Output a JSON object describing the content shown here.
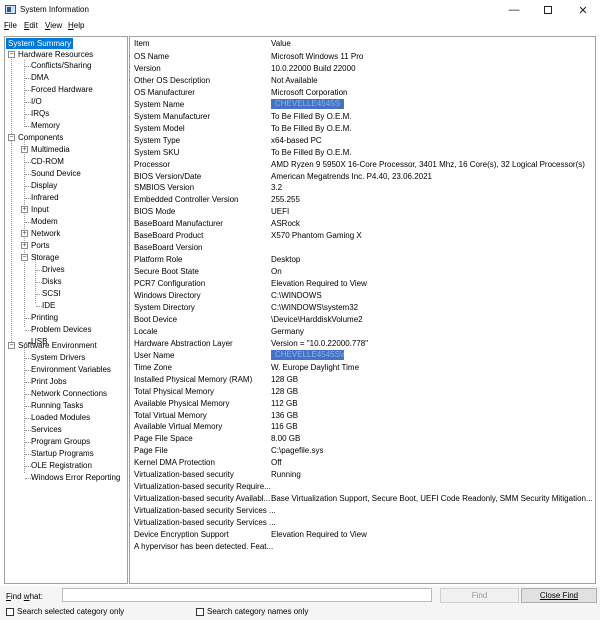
{
  "window": {
    "title": "System Information",
    "minimize": "—",
    "close": "✕"
  },
  "menu": [
    {
      "label": "File"
    },
    {
      "label": "Edit"
    },
    {
      "label": "View"
    },
    {
      "label": "Help"
    }
  ],
  "tree": {
    "system_summary": "System Summary",
    "hardware_resources": "Hardware Resources",
    "hardware_children": [
      "Conflicts/Sharing",
      "DMA",
      "Forced Hardware",
      "I/O",
      "IRQs",
      "Memory"
    ],
    "components": "Components",
    "components_children": [
      "Multimedia",
      "CD-ROM",
      "Sound Device",
      "Display",
      "Infrared",
      "Input",
      "Modem",
      "Network",
      "Ports",
      "Storage"
    ],
    "storage_children": [
      "Drives",
      "Disks",
      "SCSI",
      "IDE"
    ],
    "components_children_2": [
      "Printing",
      "Problem Devices",
      "USB"
    ],
    "software_environment": "Software Environment",
    "software_children": [
      "System Drivers",
      "Environment Variables",
      "Print Jobs",
      "Network Connections",
      "Running Tasks",
      "Loaded Modules",
      "Services",
      "Program Groups",
      "Startup Programs",
      "OLE Registration",
      "Windows Error Reporting"
    ]
  },
  "table": {
    "headers": [
      "Item",
      "Value"
    ],
    "rows": [
      [
        "OS Name",
        "Microsoft Windows 11 Pro"
      ],
      [
        "Version",
        "10.0.22000 Build 22000"
      ],
      [
        "Other OS Description",
        "Not Available"
      ],
      [
        "OS Manufacturer",
        "Microsoft Corporation"
      ],
      [
        "System Name",
        "CHEVELLE4545S"
      ],
      [
        "System Manufacturer",
        "To Be Filled By O.E.M."
      ],
      [
        "System Model",
        "To Be Filled By O.E.M."
      ],
      [
        "System Type",
        "x64-based PC"
      ],
      [
        "System SKU",
        "To Be Filled By O.E.M."
      ],
      [
        "Processor",
        "AMD Ryzen 9 5950X 16-Core Processor, 3401 Mhz, 16 Core(s), 32 Logical Processor(s)"
      ],
      [
        "BIOS Version/Date",
        "American Megatrends Inc. P4.40, 23.06.2021"
      ],
      [
        "SMBIOS Version",
        "3.2"
      ],
      [
        "Embedded Controller Version",
        "255.255"
      ],
      [
        "BIOS Mode",
        "UEFI"
      ],
      [
        "BaseBoard Manufacturer",
        "ASRock"
      ],
      [
        "BaseBoard Product",
        "X570 Phantom Gaming X"
      ],
      [
        "BaseBoard Version",
        ""
      ],
      [
        "Platform Role",
        "Desktop"
      ],
      [
        "Secure Boot State",
        "On"
      ],
      [
        "PCR7 Configuration",
        "Elevation Required to View"
      ],
      [
        "Windows Directory",
        "C:\\WINDOWS"
      ],
      [
        "System Directory",
        "C:\\WINDOWS\\system32"
      ],
      [
        "Boot Device",
        "\\Device\\HarddiskVolume2"
      ],
      [
        "Locale",
        "Germany"
      ],
      [
        "Hardware Abstraction Layer",
        "Version = \"10.0.22000.778\""
      ],
      [
        "User Name",
        "CHEVELLE4545S\\mitgerge"
      ],
      [
        "Time Zone",
        "W. Europe Daylight Time"
      ],
      [
        "Installed Physical Memory (RAM)",
        "128 GB"
      ],
      [
        "Total Physical Memory",
        "128 GB"
      ],
      [
        "Available Physical Memory",
        "112 GB"
      ],
      [
        "Total Virtual Memory",
        "136 GB"
      ],
      [
        "Available Virtual Memory",
        "116 GB"
      ],
      [
        "Page File Space",
        "8.00 GB"
      ],
      [
        "Page File",
        "C:\\pagefile.sys"
      ],
      [
        "Kernel DMA Protection",
        "Off"
      ],
      [
        "Virtualization-based security",
        "Running"
      ],
      [
        "Virtualization-based security Require...",
        ""
      ],
      [
        "Virtualization-based security Availabl...",
        "Base Virtualization Support, Secure Boot, UEFI Code Readonly, SMM Security Mitigation..."
      ],
      [
        "Virtualization-based security Services ...",
        ""
      ],
      [
        "Virtualization-based security Services ...",
        ""
      ],
      [
        "Device Encryption Support",
        "Elevation Required to View"
      ],
      [
        "A hypervisor has been detected. Feat...",
        ""
      ]
    ]
  },
  "find": {
    "label": "Find what:",
    "value": "",
    "find_button": "Find",
    "close_find_button": "Close Find",
    "search_selected": "Search selected category only",
    "search_names": "Search category names only"
  }
}
